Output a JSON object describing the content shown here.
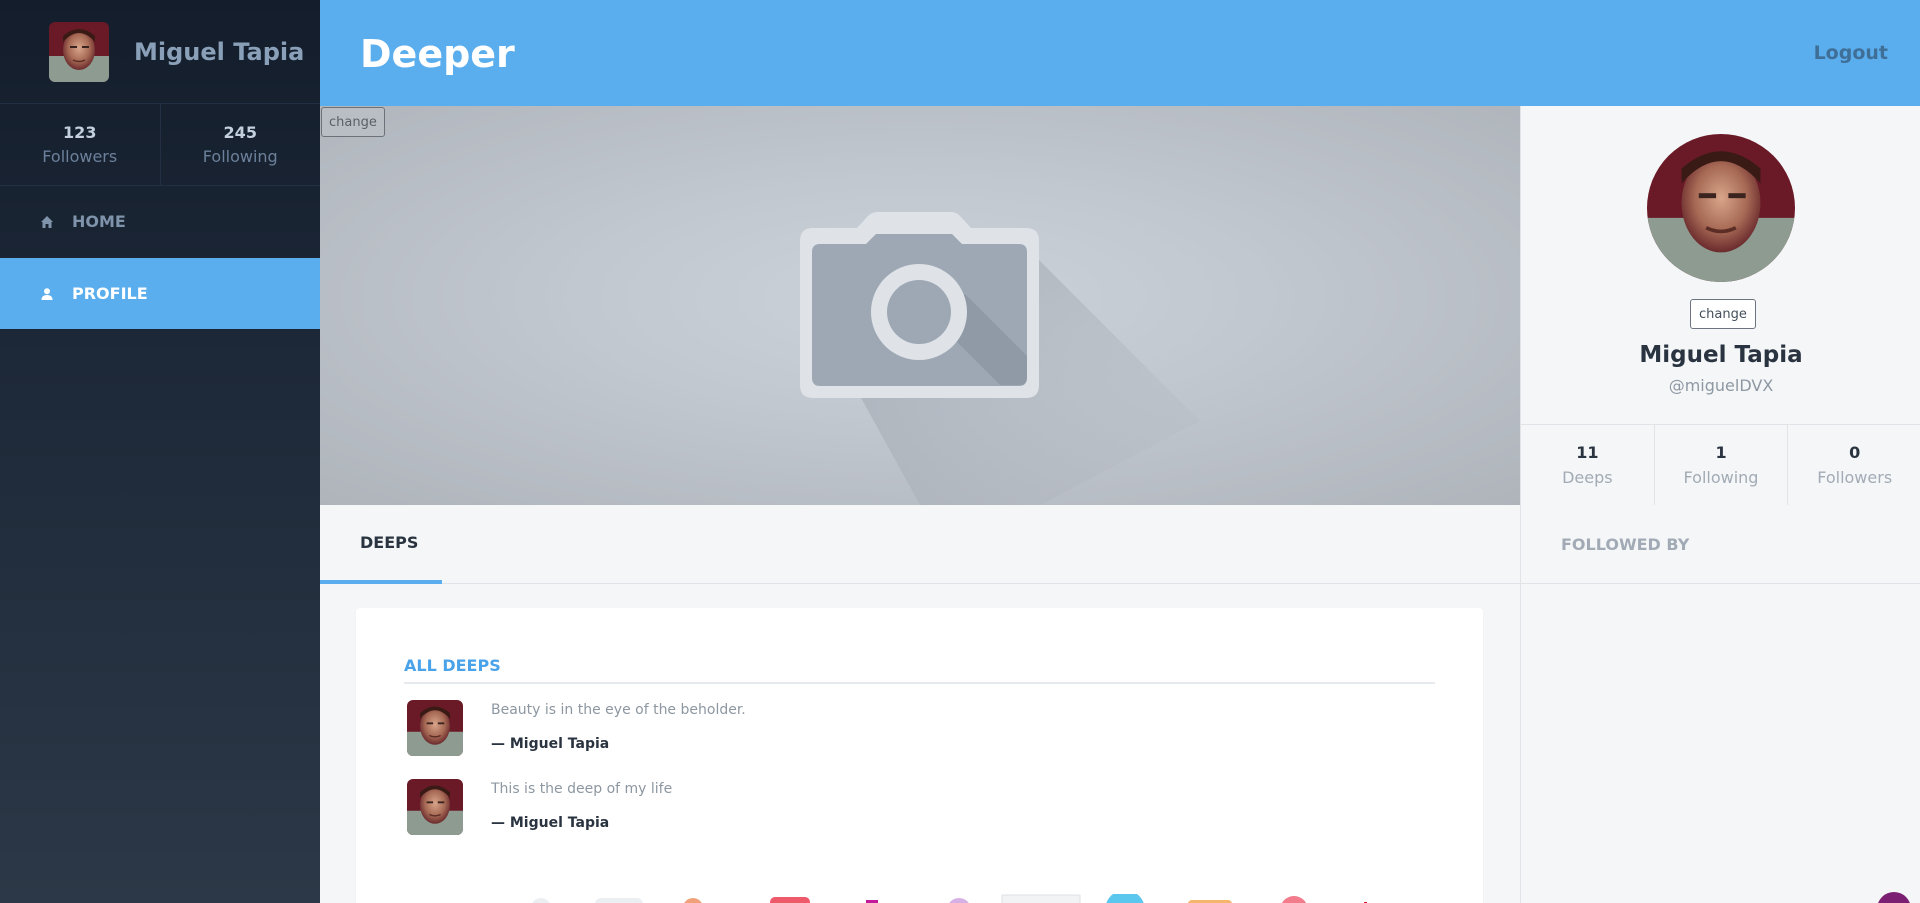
{
  "sidebar": {
    "user_name": "Miguel Tapia",
    "stats": [
      {
        "value": "123",
        "label": "Followers"
      },
      {
        "value": "245",
        "label": "Following"
      }
    ],
    "nav": [
      {
        "label": "HOME",
        "icon": "home-icon",
        "active": false
      },
      {
        "label": "PROFILE",
        "icon": "user-icon",
        "active": true
      }
    ]
  },
  "header": {
    "brand": "Deeper",
    "logout": "Logout"
  },
  "cover": {
    "change_label": "change",
    "placeholder_icon": "camera-icon"
  },
  "profile": {
    "change_label": "change",
    "name": "Miguel Tapia",
    "handle": "@miguelDVX",
    "stats": [
      {
        "value": "11",
        "label": "Deeps"
      },
      {
        "value": "1",
        "label": "Following"
      },
      {
        "value": "0",
        "label": "Followers"
      }
    ]
  },
  "tabs": {
    "active": "DEEPS"
  },
  "side": {
    "followed_by_heading": "FOLLOWED BY"
  },
  "deeps": {
    "heading": "ALL DEEPS",
    "items": [
      {
        "text": "Beauty is in the eye of the beholder.",
        "author": "— Miguel Tapia"
      },
      {
        "text": "This is the deep of my life",
        "author": "— Miguel Tapia"
      }
    ]
  },
  "colors": {
    "accent": "#5baeed",
    "sidebar_bg": "#1d2838",
    "text_dark": "#2a3440"
  }
}
